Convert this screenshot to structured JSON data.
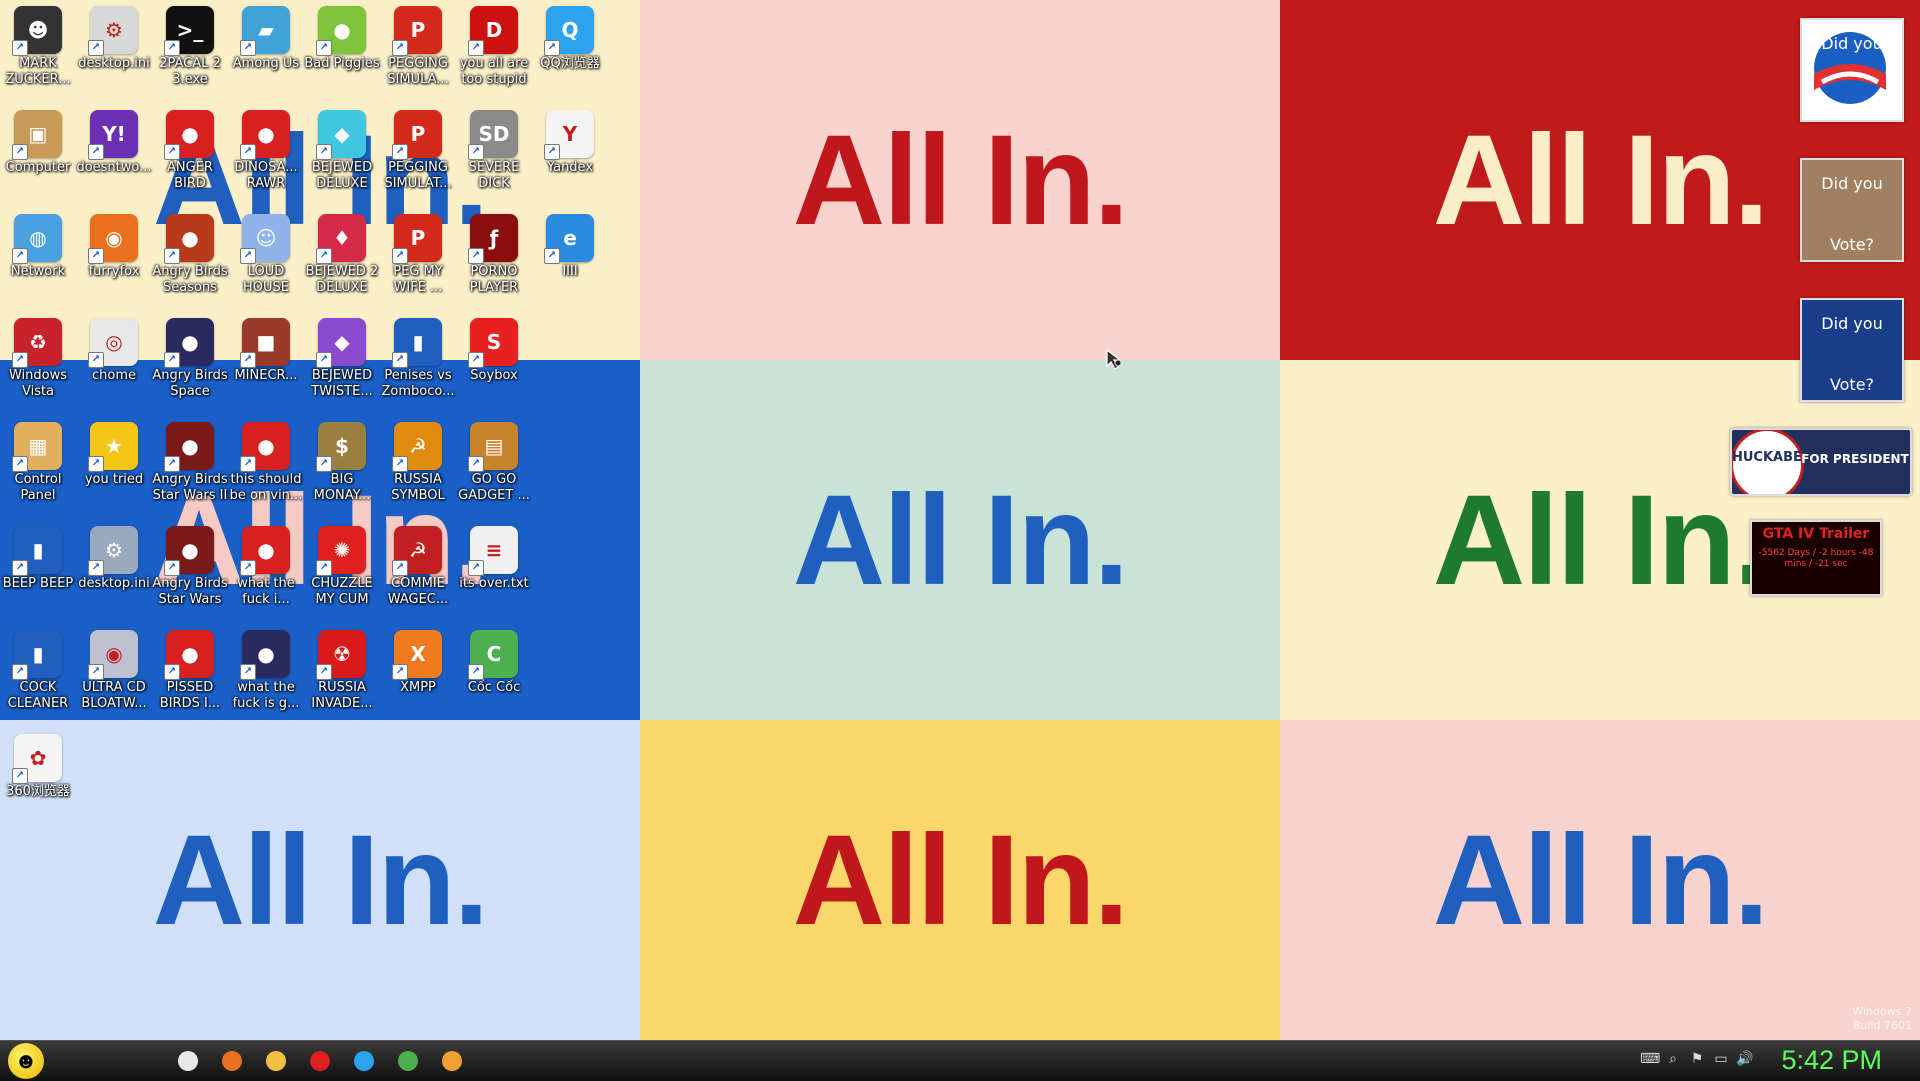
{
  "wallpaper": {
    "tiles": [
      {
        "text": "All In.",
        "bg": "#fbefc8",
        "fg": "#1f5fbf"
      },
      {
        "text": "All In.",
        "bg": "#f8d2cc",
        "fg": "#c0171d"
      },
      {
        "text": "All In.",
        "bg": "#bf1b1b",
        "fg": "#f9edc8"
      },
      {
        "text": "All In.",
        "bg": "#1a5fc7",
        "fg": "#f6cbc4"
      },
      {
        "text": "All In.",
        "bg": "#c9e3d6",
        "fg": "#1f5fbf"
      },
      {
        "text": "All In.",
        "bg": "#fbefc8",
        "fg": "#1e7a2e"
      },
      {
        "text": "All In.",
        "bg": "#cfe0f8",
        "fg": "#1f5fbf"
      },
      {
        "text": "All In.",
        "bg": "#fbd66a",
        "fg": "#c0171d"
      },
      {
        "text": "All In.",
        "bg": "#f8d2cc",
        "fg": "#1f5fbf"
      }
    ]
  },
  "desktop_icons": [
    {
      "label": "MARK ZUCKER...",
      "icon": "person-icon",
      "color": "#333333",
      "glyph": "☻"
    },
    {
      "label": "desktop.ini",
      "icon": "settings-file-icon",
      "color": "#d8d8d8",
      "glyph": "⚙"
    },
    {
      "label": "2PACAL 2 3.exe",
      "icon": "console-icon",
      "color": "#111111",
      "glyph": ">_"
    },
    {
      "label": "Among Us",
      "icon": "folder-icon",
      "color": "#3fa3d8",
      "glyph": "▰"
    },
    {
      "label": "Bad Piggies",
      "icon": "pig-icon",
      "color": "#7ec43b",
      "glyph": "●"
    },
    {
      "label": "PEGGING SIMULA...",
      "icon": "peggle-icon",
      "color": "#d42a1c",
      "glyph": "P"
    },
    {
      "label": "you all are too stupid",
      "icon": "devcpp-icon",
      "color": "#cc1111",
      "glyph": "D"
    },
    {
      "label": "QQ浏览器",
      "icon": "qq-browser-icon",
      "color": "#2ba3f0",
      "glyph": "Q"
    },
    {
      "label": "Computer",
      "icon": "computer-icon",
      "color": "#c89a55",
      "glyph": "▣"
    },
    {
      "label": "doesntwo...",
      "icon": "yahoo-messenger-icon",
      "color": "#6a2fb3",
      "glyph": "Y!"
    },
    {
      "label": "ANGER BIRD",
      "icon": "angry-bird-icon",
      "color": "#d82020",
      "glyph": "●"
    },
    {
      "label": "DINOSA... RAWR",
      "icon": "angry-bird-icon",
      "color": "#d82020",
      "glyph": "●"
    },
    {
      "label": "BEJEWED DELUXE",
      "icon": "gem-icon",
      "color": "#3fc6e0",
      "glyph": "◆"
    },
    {
      "label": "PEGGING SIMULAT...",
      "icon": "peggle-icon",
      "color": "#d42a1c",
      "glyph": "P"
    },
    {
      "label": "SEVERE DICK",
      "icon": "gear-sd-icon",
      "color": "#8a8a8a",
      "glyph": "SD"
    },
    {
      "label": "Yandex",
      "icon": "yandex-icon",
      "color": "#f4f4f4",
      "glyph": "Y"
    },
    {
      "label": "Network",
      "icon": "network-globe-icon",
      "color": "#4aa0e0",
      "glyph": "◍"
    },
    {
      "label": "furryfox",
      "icon": "firefox-icon",
      "color": "#e8701f",
      "glyph": "◉"
    },
    {
      "label": "Angry Birds Seasons",
      "icon": "angry-bird-icon",
      "color": "#b83a1a",
      "glyph": "●"
    },
    {
      "label": "LOUD HOUSE",
      "icon": "character-icon",
      "color": "#8fb2e8",
      "glyph": "☺"
    },
    {
      "label": "BEJEWED 2 DELUXE",
      "icon": "gem-icon",
      "color": "#d42a48",
      "glyph": "♦"
    },
    {
      "label": "PEG MY WIFE ...",
      "icon": "peggle-icon",
      "color": "#d42a1c",
      "glyph": "P"
    },
    {
      "label": "PORNO PLAYER",
      "icon": "flash-player-icon",
      "color": "#8a0e0e",
      "glyph": "ƒ"
    },
    {
      "label": "IIII",
      "icon": "internet-explorer-icon",
      "color": "#2a8ce0",
      "glyph": "e"
    },
    {
      "label": "Windows Vista",
      "icon": "recycle-bin-icon",
      "color": "#c8222a",
      "glyph": "♻"
    },
    {
      "label": "chome",
      "icon": "chrome-icon",
      "color": "#e8e8e8",
      "glyph": "◎"
    },
    {
      "label": "Angry Birds Space",
      "icon": "angry-bird-icon",
      "color": "#2a2a60",
      "glyph": "●"
    },
    {
      "label": "MINECR...",
      "icon": "minecraft-icon",
      "color": "#9a3a2a",
      "glyph": "■"
    },
    {
      "label": "BEJEWED TWISTE...",
      "icon": "gem-icon",
      "color": "#8a4ad0",
      "glyph": "◆"
    },
    {
      "label": "Penises vs Zomboco...",
      "icon": "blank-file-icon",
      "color": "#1f5fbf",
      "glyph": "▮"
    },
    {
      "label": "Soybox",
      "icon": "soybox-icon",
      "color": "#e82020",
      "glyph": "S"
    },
    {
      "label": "Control Panel",
      "icon": "control-panel-icon",
      "color": "#e0b060",
      "glyph": "▦"
    },
    {
      "label": "you tried",
      "icon": "star-icon",
      "color": "#f5c518",
      "glyph": "★"
    },
    {
      "label": "Angry Birds Star Wars II",
      "icon": "angry-bird-icon",
      "color": "#7a1a1a",
      "glyph": "●"
    },
    {
      "label": "this should be on vin...",
      "icon": "angry-bird-icon",
      "color": "#d82020",
      "glyph": "●"
    },
    {
      "label": "BIG MONAY...",
      "icon": "money-bag-icon",
      "color": "#9a8040",
      "glyph": "$"
    },
    {
      "label": "RUSSIA SYMBOL",
      "icon": "hammer-sickle-icon",
      "color": "#e08a10",
      "glyph": "☭"
    },
    {
      "label": "GO GO GADGET ...",
      "icon": "briefcase-icon",
      "color": "#c8842a",
      "glyph": "▤"
    },
    {
      "label": "BEEP BEEP",
      "icon": "blank-file-icon",
      "color": "#1f5fbf",
      "glyph": "▮"
    },
    {
      "label": "desktop.ini",
      "icon": "settings-file-icon",
      "color": "#9aa8c0",
      "glyph": "⚙"
    },
    {
      "label": "Angry Birds Star Wars",
      "icon": "angry-bird-icon",
      "color": "#7a1a1a",
      "glyph": "●"
    },
    {
      "label": "what the fuck i...",
      "icon": "angry-bird-icon",
      "color": "#d82020",
      "glyph": "●"
    },
    {
      "label": "CHUZZLE MY CUM",
      "icon": "chuzzle-icon",
      "color": "#e02020",
      "glyph": "✺"
    },
    {
      "label": "COMMIE WAGEC...",
      "icon": "hammer-sickle-icon",
      "color": "#c02020",
      "glyph": "☭"
    },
    {
      "label": "its over.txt",
      "icon": "text-file-icon",
      "color": "#f0f0f0",
      "glyph": "≡"
    },
    {
      "label": "COCK CLEANER",
      "icon": "blank-file-icon",
      "color": "#1f5fbf",
      "glyph": "▮"
    },
    {
      "label": "ULTRA CD BLOATW...",
      "icon": "cd-icon",
      "color": "#c0c0d0",
      "glyph": "◉"
    },
    {
      "label": "PISSED BIRDS I...",
      "icon": "angry-bird-icon",
      "color": "#d82020",
      "glyph": "●"
    },
    {
      "label": "what the fuck is g...",
      "icon": "angry-bird-icon",
      "color": "#2a2a60",
      "glyph": "●"
    },
    {
      "label": "RUSSIA INVADE...",
      "icon": "radiation-icon",
      "color": "#d81a1a",
      "glyph": "☢"
    },
    {
      "label": "XMPP",
      "icon": "xampp-icon",
      "color": "#f07a20",
      "glyph": "X"
    },
    {
      "label": "Cốc Cốc",
      "icon": "coccoc-icon",
      "color": "#4caf50",
      "glyph": "C"
    },
    {
      "label": "360浏览器",
      "icon": "360-browser-icon",
      "color": "#f4f4f4",
      "glyph": "✿"
    }
  ],
  "gadgets": [
    {
      "name": "obama-vote-gadget",
      "text_top": "Did you",
      "text_bottom": "",
      "bg": "#ffffff"
    },
    {
      "name": "mccain-vote-gadget",
      "text_top": "Did you",
      "text_bottom": "Vote?",
      "bg": "#a08060"
    },
    {
      "name": "hillary-vote-gadget",
      "text_top": "Did you",
      "text_bottom": "Vote?",
      "bg": "#1a3d8a"
    },
    {
      "name": "huckabee-gadget",
      "text_top": "HUCKABEE",
      "text_bottom": "FOR PRESIDENT",
      "bg": "#23305e"
    },
    {
      "name": "gta-iv-trailer-gadget",
      "text_top": "GTA IV Trailer",
      "text_bottom": "-5562 Days / -2 hours -48 mins / -21 sec",
      "bg": "#1a0000"
    }
  ],
  "taskbar": {
    "start_icon": "smiley-start-icon",
    "pinned": [
      {
        "name": "chrome-taskbar-icon",
        "color": "#e8e8e8"
      },
      {
        "name": "firefox-taskbar-icon",
        "color": "#e8701f"
      },
      {
        "name": "explorer-taskbar-icon",
        "color": "#f0c040"
      },
      {
        "name": "yandex-taskbar-icon",
        "color": "#e02020"
      },
      {
        "name": "qq-browser-taskbar-icon",
        "color": "#2ba3f0"
      },
      {
        "name": "coccoc-taskbar-icon",
        "color": "#4caf50"
      },
      {
        "name": "360-taskbar-icon",
        "color": "#f0a030"
      }
    ],
    "tray": [
      {
        "name": "keyboard-icon",
        "glyph": "⌨"
      },
      {
        "name": "search-icon",
        "glyph": "⌕"
      },
      {
        "name": "flag-icon",
        "glyph": "⚑"
      },
      {
        "name": "network-icon",
        "glyph": "▭"
      },
      {
        "name": "volume-icon",
        "glyph": "🔊"
      }
    ],
    "clock": "5:42 PM"
  },
  "watermark": {
    "line1": "Windows 7",
    "line2": "Build 7601"
  }
}
